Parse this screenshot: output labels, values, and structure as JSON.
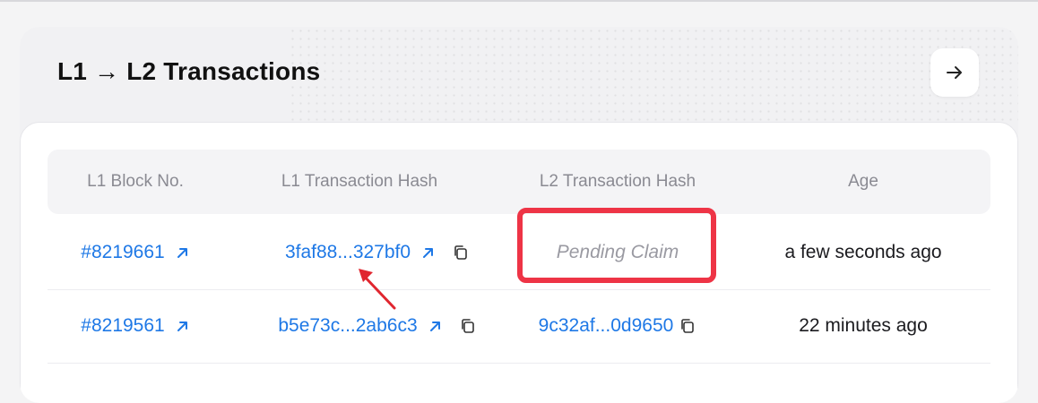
{
  "panel": {
    "title": "L1 → L2 Transactions"
  },
  "table": {
    "headers": [
      "L1 Block No.",
      "L1 Transaction Hash",
      "L2 Transaction Hash",
      "Age"
    ],
    "rows": [
      {
        "l1_block": "#8219661",
        "l1_hash": "3faf88...327bf0",
        "l2_hash": "Pending Claim",
        "age": "a few seconds ago"
      },
      {
        "l1_block": "#8219561",
        "l1_hash": "b5e73c...2ab6c3",
        "l2_hash": "9c32af...0d9650",
        "age": "22 minutes ago"
      }
    ]
  },
  "icons": {
    "nav": "arrow-right-icon",
    "external": "external-link-icon",
    "copy": "copy-icon"
  },
  "colors": {
    "link": "#1e78e6",
    "highlight": "#ee3446",
    "muted": "#8a8a92"
  }
}
